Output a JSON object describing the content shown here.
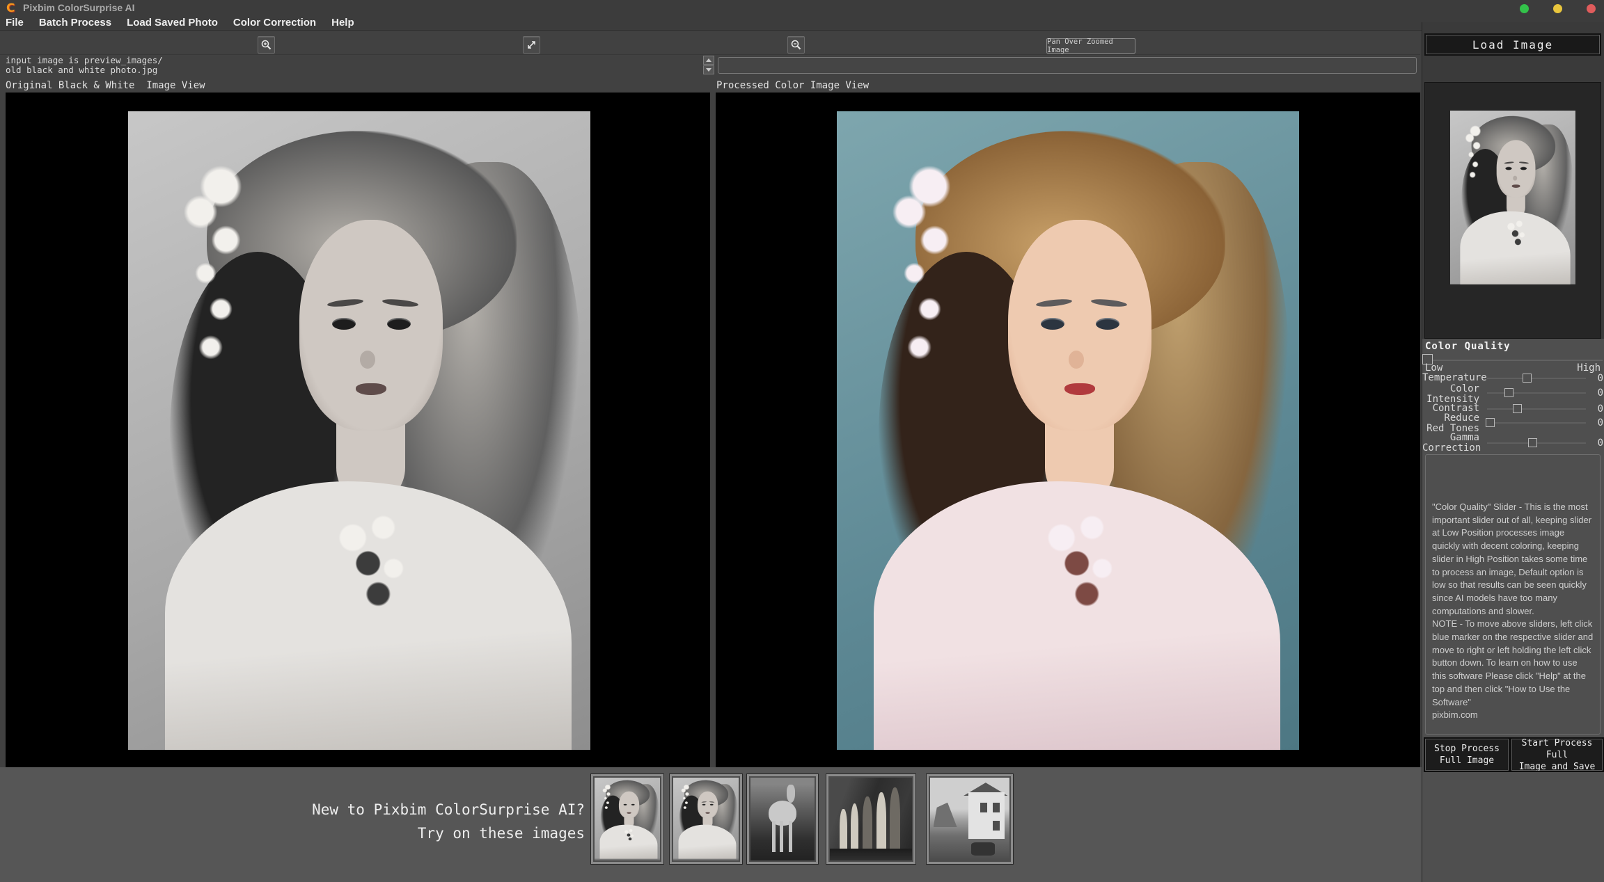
{
  "title_bar": {
    "logo_letter": "C",
    "app_title": "Pixbim ColorSurprise AI",
    "window_buttons": [
      "green",
      "yellow",
      "red"
    ]
  },
  "menu_bar": {
    "items": [
      "File",
      "Batch Process",
      "Load Saved Photo",
      "Color Correction",
      "Help"
    ]
  },
  "toolbar": {
    "zoom_in_icon": "magnifier-plus",
    "expand_icon": "diagonal-resize-arrows",
    "zoom_out_icon": "magnifier-minus",
    "pan_button_label": "Pan Over Zoomed Image"
  },
  "status": {
    "message_line1": "input image is preview_images/",
    "message_line2": "old black and white photo.jpg",
    "right_input_value": ""
  },
  "panels": {
    "left_label": "Original Black & White  Image View",
    "right_label": "Processed Color Image View",
    "left_content": "black-and-white-girl-portrait",
    "right_content": "colorized-girl-portrait"
  },
  "sidebar": {
    "load_image_label": "Load Image",
    "preview_thumbnail": "black-and-white-girl-portrait",
    "color_quality": {
      "title": "Color Quality",
      "low_label": "Low",
      "high_label": "High",
      "quality_percent": 0,
      "sliders": [
        {
          "label": "Temperature",
          "value": "0",
          "percent": 40
        },
        {
          "label": "Color Intensity",
          "value": "0",
          "percent": 22
        },
        {
          "label": "Contrast",
          "value": "0",
          "percent": 30
        },
        {
          "label": "Reduce Red Tones",
          "value": "0",
          "percent": 3
        },
        {
          "label": "Gamma Correction",
          "value": "0",
          "percent": 46
        }
      ]
    },
    "help_text": "\"Color Quality\" Slider - This is the most important slider out of all, keeping slider at Low Position processes image quickly with decent coloring, keeping slider in High Position takes some time to process an image, Default option is low so that results can be seen quickly since AI models have too many computations and slower.\nNOTE - To move above sliders, left click blue marker on the respective slider and move to right or left holding the left click button down. To learn on how to use this software Please click \"Help\" at the top and then click \"How to Use the Software\"\npixbim.com",
    "stop_button_label": "Stop Process\nFull Image",
    "start_button_label": "Start Process Full\nImage and Save"
  },
  "footer": {
    "promo_line1": "New to Pixbim ColorSurprise AI?",
    "promo_line2": "Try on these images",
    "sample_images": [
      "woman-portrait",
      "girl-portrait",
      "deer",
      "family-group",
      "farm-house"
    ]
  },
  "colors": {
    "logo_orange": "#f5941d",
    "window_dot_green": "#33c24a",
    "window_dot_yellow": "#e9c63d",
    "window_dot_red": "#e05c5c",
    "ui_background": "#414141",
    "sidebar_lower": "#4f4f4f",
    "footer_gray": "#565656",
    "panel_black": "#000000",
    "colorized_background_teal": "#5d8894",
    "colorized_hair_gold": "#c9a169",
    "colorized_lips_red": "#b13a3d"
  }
}
